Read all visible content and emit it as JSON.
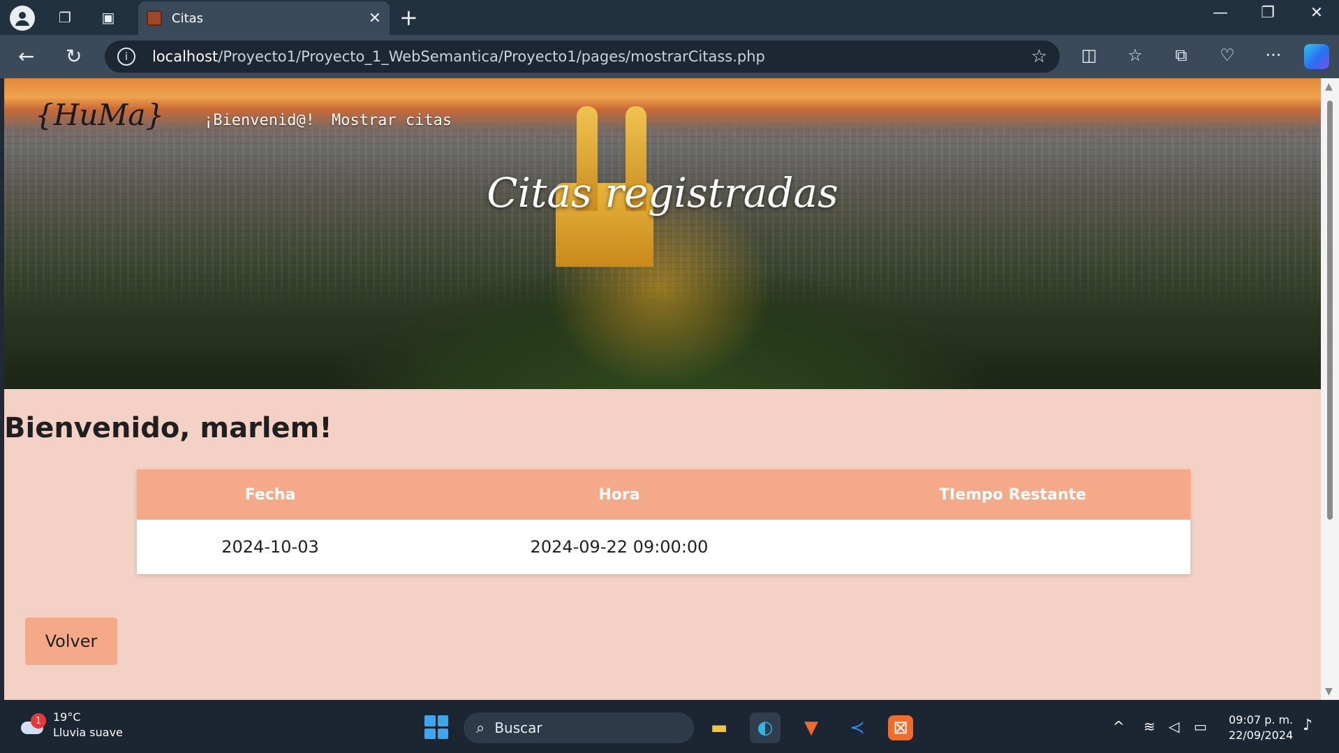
{
  "browser": {
    "tab_title": "Citas",
    "url_host": "localhost",
    "url_path": "/Proyecto1/Proyecto_1_WebSemantica/Proyecto1/pages/mostrarCitass.php"
  },
  "page": {
    "logo_text": "{HuMa}",
    "nav": [
      "¡Bienvenid@!",
      "Mostrar citas"
    ],
    "hero_title": "Citas registradas",
    "welcome": "Bienvenido, marlem!",
    "table": {
      "headers": [
        "Fecha",
        "Hora",
        "TIempo Restante"
      ],
      "rows": [
        [
          "2024-10-03",
          "2024-09-22 09:00:00",
          ""
        ]
      ]
    },
    "back_button": "Volver"
  },
  "taskbar": {
    "weather_temp": "19°C",
    "weather_desc": "Lluvia suave",
    "weather_badge": "1",
    "search_placeholder": "Buscar",
    "time": "09:07 p. m.",
    "date": "22/09/2024"
  },
  "colors": {
    "page_bg": "#f3d1c4",
    "table_header": "#f4a989",
    "button_bg": "#f4a989",
    "chrome_dark": "#223140"
  }
}
